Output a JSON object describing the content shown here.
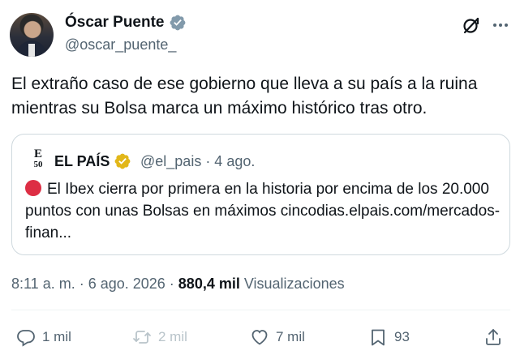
{
  "author": {
    "name": "Óscar Puente",
    "handle": "@oscar_puente_"
  },
  "tweet": {
    "text": "El extraño caso de ese gobierno que lleva a su país a la ruina mientras su Bolsa marca un máximo histórico tras otro."
  },
  "quote": {
    "logo_top": "E",
    "logo_bottom": "50",
    "name": "EL PAÍS",
    "meta": "@el_pais · 4 ago.",
    "text": "El Ibex cierra por primera en la historia por encima de los 20.000 puntos con unas Bolsas en máximos cincodias.elpais.com/mercados-finan..."
  },
  "meta": {
    "time": "8:11 a. m. · 6 ago. 2026 · ",
    "views_count": "880,4 mil",
    "views_label": " Visualizaciones"
  },
  "actions": {
    "replies": "1 mil",
    "reposts": "2 mil",
    "likes": "7 mil",
    "bookmarks": "93"
  },
  "colors": {
    "verified_blue": "#1d9bf0",
    "verified_gold": "#e2b719",
    "secondary_text": "#536471",
    "border": "#cfd9de"
  }
}
